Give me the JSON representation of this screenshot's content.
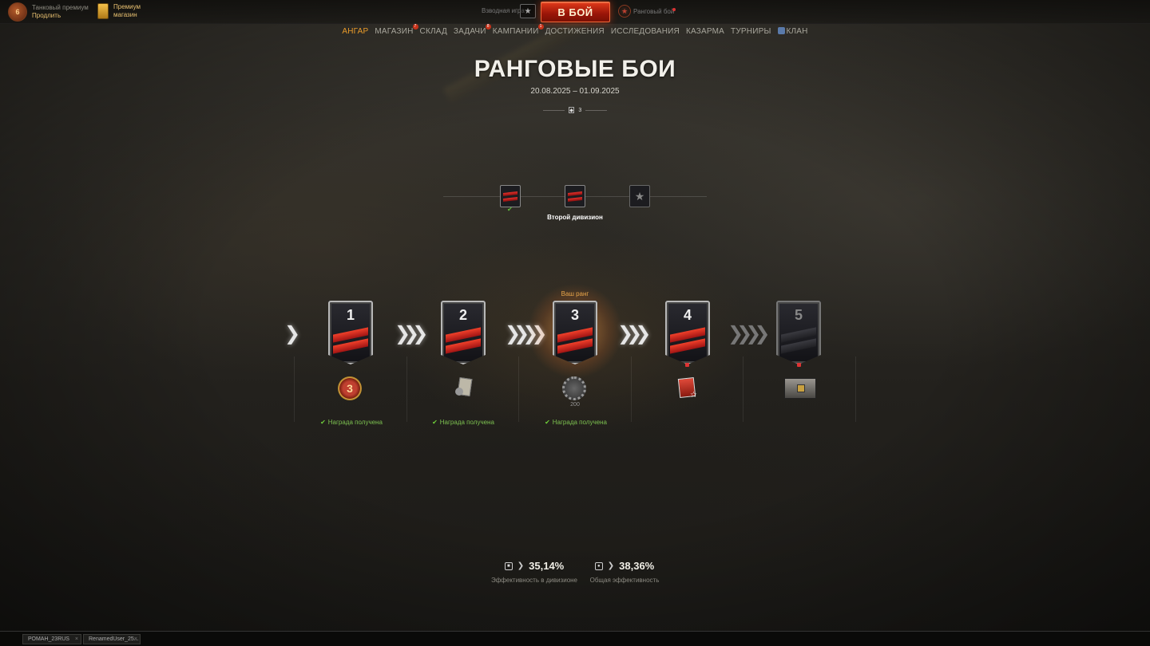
{
  "header": {
    "premium_tank_line1": "Танковый премиум",
    "premium_tank_line2": "Продлить",
    "premium_level": "6",
    "premium_shop_line1": "Премиум",
    "premium_shop_line2": "магазин",
    "platoon_label": "Взводная игра",
    "battle_button": "В БОЙ",
    "mode_label": "Ранговый бой"
  },
  "nav": {
    "items": [
      {
        "label": "АНГАР",
        "active": true
      },
      {
        "label": "МАГАЗИН",
        "badge": "7"
      },
      {
        "label": "СКЛАД"
      },
      {
        "label": "ЗАДАЧИ",
        "badge": "8"
      },
      {
        "label": "КАМПАНИИ",
        "badge": "1"
      },
      {
        "label": "ДОСТИЖЕНИЯ"
      },
      {
        "label": "ИССЛЕДОВАНИЯ"
      },
      {
        "label": "КАЗАРМА"
      },
      {
        "label": "ТУРНИРЫ"
      },
      {
        "label": "КЛАН"
      }
    ]
  },
  "page": {
    "title": "РАНГОВЫЕ БОИ",
    "dates": "20.08.2025 – 01.09.2025",
    "season_number": "3"
  },
  "divisions": {
    "current_label": "Второй дивизион"
  },
  "ranks": {
    "your_rank_label": "Ваш ранг",
    "items": [
      {
        "number": "1",
        "reward": "3",
        "status": "Награда получена"
      },
      {
        "number": "2",
        "status": "Награда получена"
      },
      {
        "number": "3",
        "reward_value": "200",
        "status": "Награда получена"
      },
      {
        "number": "4"
      },
      {
        "number": "5"
      }
    ]
  },
  "efficiency": {
    "division_value": "35,14%",
    "division_label": "Эффективность в дивизионе",
    "total_value": "38,36%",
    "total_label": "Общая эффективность"
  },
  "chat": {
    "tab1": "РОМАН_23RUS",
    "tab2": "RenamedUser_25..."
  },
  "colors": {
    "accent_orange": "#e89a2a",
    "battle_red": "#c8321a",
    "success_green": "#7cc050"
  }
}
